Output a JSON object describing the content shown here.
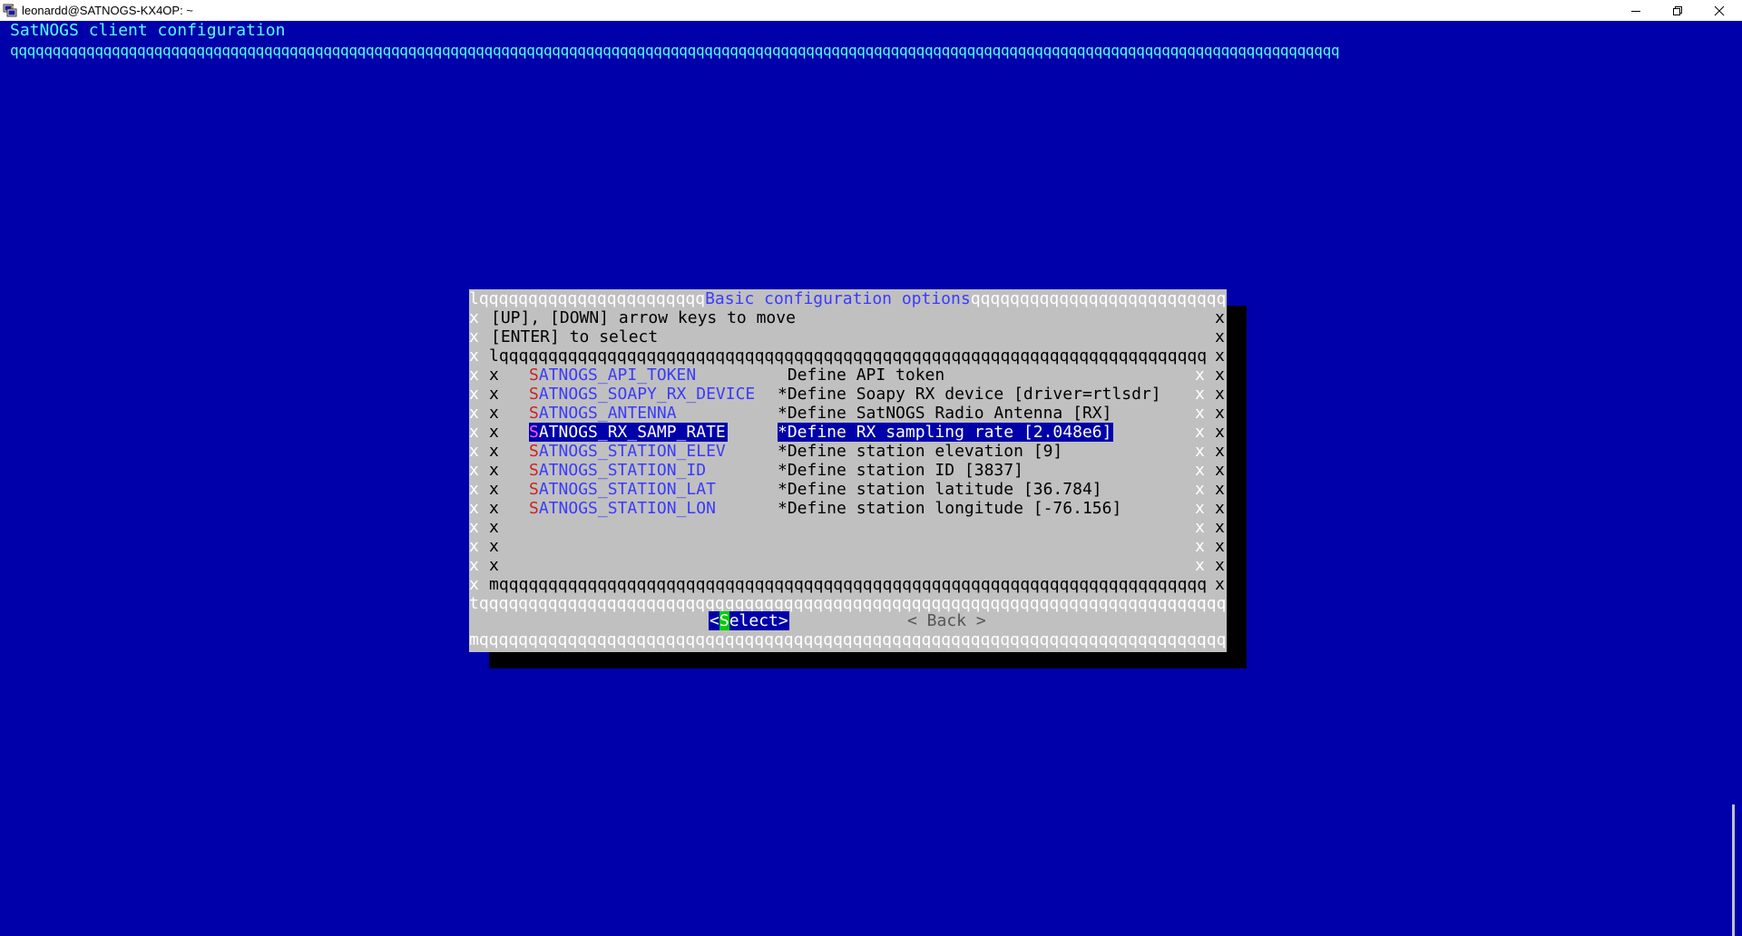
{
  "window": {
    "title": "leonardd@SATNOGS-KX4OP: ~",
    "icon": "putty-icon",
    "controls": [
      "minimize",
      "restore",
      "close"
    ]
  },
  "terminal": {
    "heading": "SatNOGS client configuration",
    "heading_rule": "qqqqqqqqqqqqqqqqqqqqqqqqqqqqqqqqqqqqqqqqqqqqqqqqqqqqqqqqqqqqqqqqqqqqqqqqqqqqqqqqqqqqqqqqqqqqqqqqqqqqqqqqqqqqqqqqqqqqqqqqqqqqqqqqqqqqqqqqqqqqqqqqqqqqqqqqqqqqq"
  },
  "dialog": {
    "title": "Basic configuration options",
    "frame_top_left": "lqqqqqqqqqqqqqqqqqqqqqqq",
    "frame_top_right": "qqqqqqqqqqqqqqqqqqqqqqqqqqk",
    "instructions": [
      "[UP], [DOWN] arrow keys to move",
      "[ENTER] to select"
    ],
    "menu_top": "lqqqqqqqqqqqqqqqqqqqqqqqqqqqqqqqqqqqqqqqqqqqqqqqqqqqqqqqqqqqqqqqqqqqqqqqqk",
    "menu_bottom": "mqqqqqqqqqqqqqqqqqqqqqqqqqqqqqqqqqqqqqqqqqqqqqqqqqqqqqqqqqqqqqqqqqqqqqqqqj",
    "separator": "tqqqqqqqqqqqqqqqqqqqqqqqqqqqqqqqqqqqqqqqqqqqqqqqqqqqqqqqqqqqqqqqqqqqqqqqqqqqqqu",
    "bottom": "mqqqqqqqqqqqqqqqqqqqqqqqqqqqqqqqqqqqqqqqqqqqqqqqqqqqqqqqqqqqqqqqqqqqqqqqqqqqqqj",
    "border_char": "x",
    "menu_items": [
      {
        "first": "S",
        "rest": "ATNOGS_API_TOKEN",
        "desc": " Define API token"
      },
      {
        "first": "S",
        "rest": "ATNOGS_SOAPY_RX_DEVICE",
        "desc": "*Define Soapy RX device [driver=rtlsdr]"
      },
      {
        "first": "S",
        "rest": "ATNOGS_ANTENNA",
        "desc": "*Define SatNOGS Radio Antenna [RX]"
      },
      {
        "first": "S",
        "rest": "ATNOGS_RX_SAMP_RATE",
        "desc": "*Define RX sampling rate [2.048e6]"
      },
      {
        "first": "S",
        "rest": "ATNOGS_STATION_ELEV",
        "desc": "*Define station elevation [9]"
      },
      {
        "first": "S",
        "rest": "ATNOGS_STATION_ID",
        "desc": "*Define station ID [3837]"
      },
      {
        "first": "S",
        "rest": "ATNOGS_STATION_LAT",
        "desc": "*Define station latitude [36.784]"
      },
      {
        "first": "S",
        "rest": "ATNOGS_STATION_LON",
        "desc": "*Define station longitude [-76.156]"
      }
    ],
    "selected_index": 3,
    "buttons": {
      "select_open": "<",
      "select_hot": "S",
      "select_rest": "elect>",
      "back": "< Back >"
    }
  },
  "colors": {
    "background": "#0000aa",
    "dialog": "#c0c0c0",
    "highlight": "#0000aa",
    "hotkey": "#00cc00",
    "title": "#55ffff"
  }
}
